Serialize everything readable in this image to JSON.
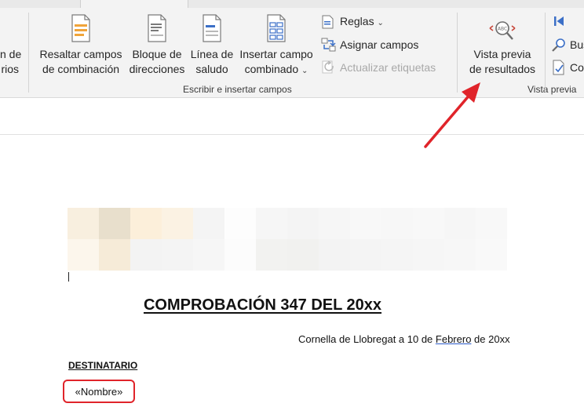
{
  "ribbon": {
    "cut_left": {
      "line1": "n de",
      "line2": "rios"
    },
    "resaltar": {
      "line1": "Resaltar campos",
      "line2": "de combinación"
    },
    "bloque": {
      "line1": "Bloque de",
      "line2": "direcciones"
    },
    "linea": {
      "line1": "Línea de",
      "line2": "saludo"
    },
    "insertar": {
      "line1": "Insertar campo",
      "line2": "combinado"
    },
    "reglas": "Reglas",
    "asignar": "Asignar campos",
    "actualizar": "Actualizar etiquetas",
    "group_escribir": "Escribir e insertar campos",
    "vista": {
      "line1": "Vista previa",
      "line2": "de resultados"
    },
    "group_vista": "Vista previa",
    "bus": "Bus",
    "co": "Co"
  },
  "document": {
    "title": "COMPROBACIÓN 347 DEL 20xx",
    "place_pre": "Cornella de Llobregat a 10 de ",
    "place_month": "Febrero",
    "place_post": " de 20xx",
    "destinatario": "DESTINATARIO",
    "nombre_field": "«Nombre»"
  },
  "colors": {
    "annotation_red": "#e0242a",
    "ribbon_bg": "#f3f3f3",
    "accent_blue": "#2b5bc9"
  }
}
